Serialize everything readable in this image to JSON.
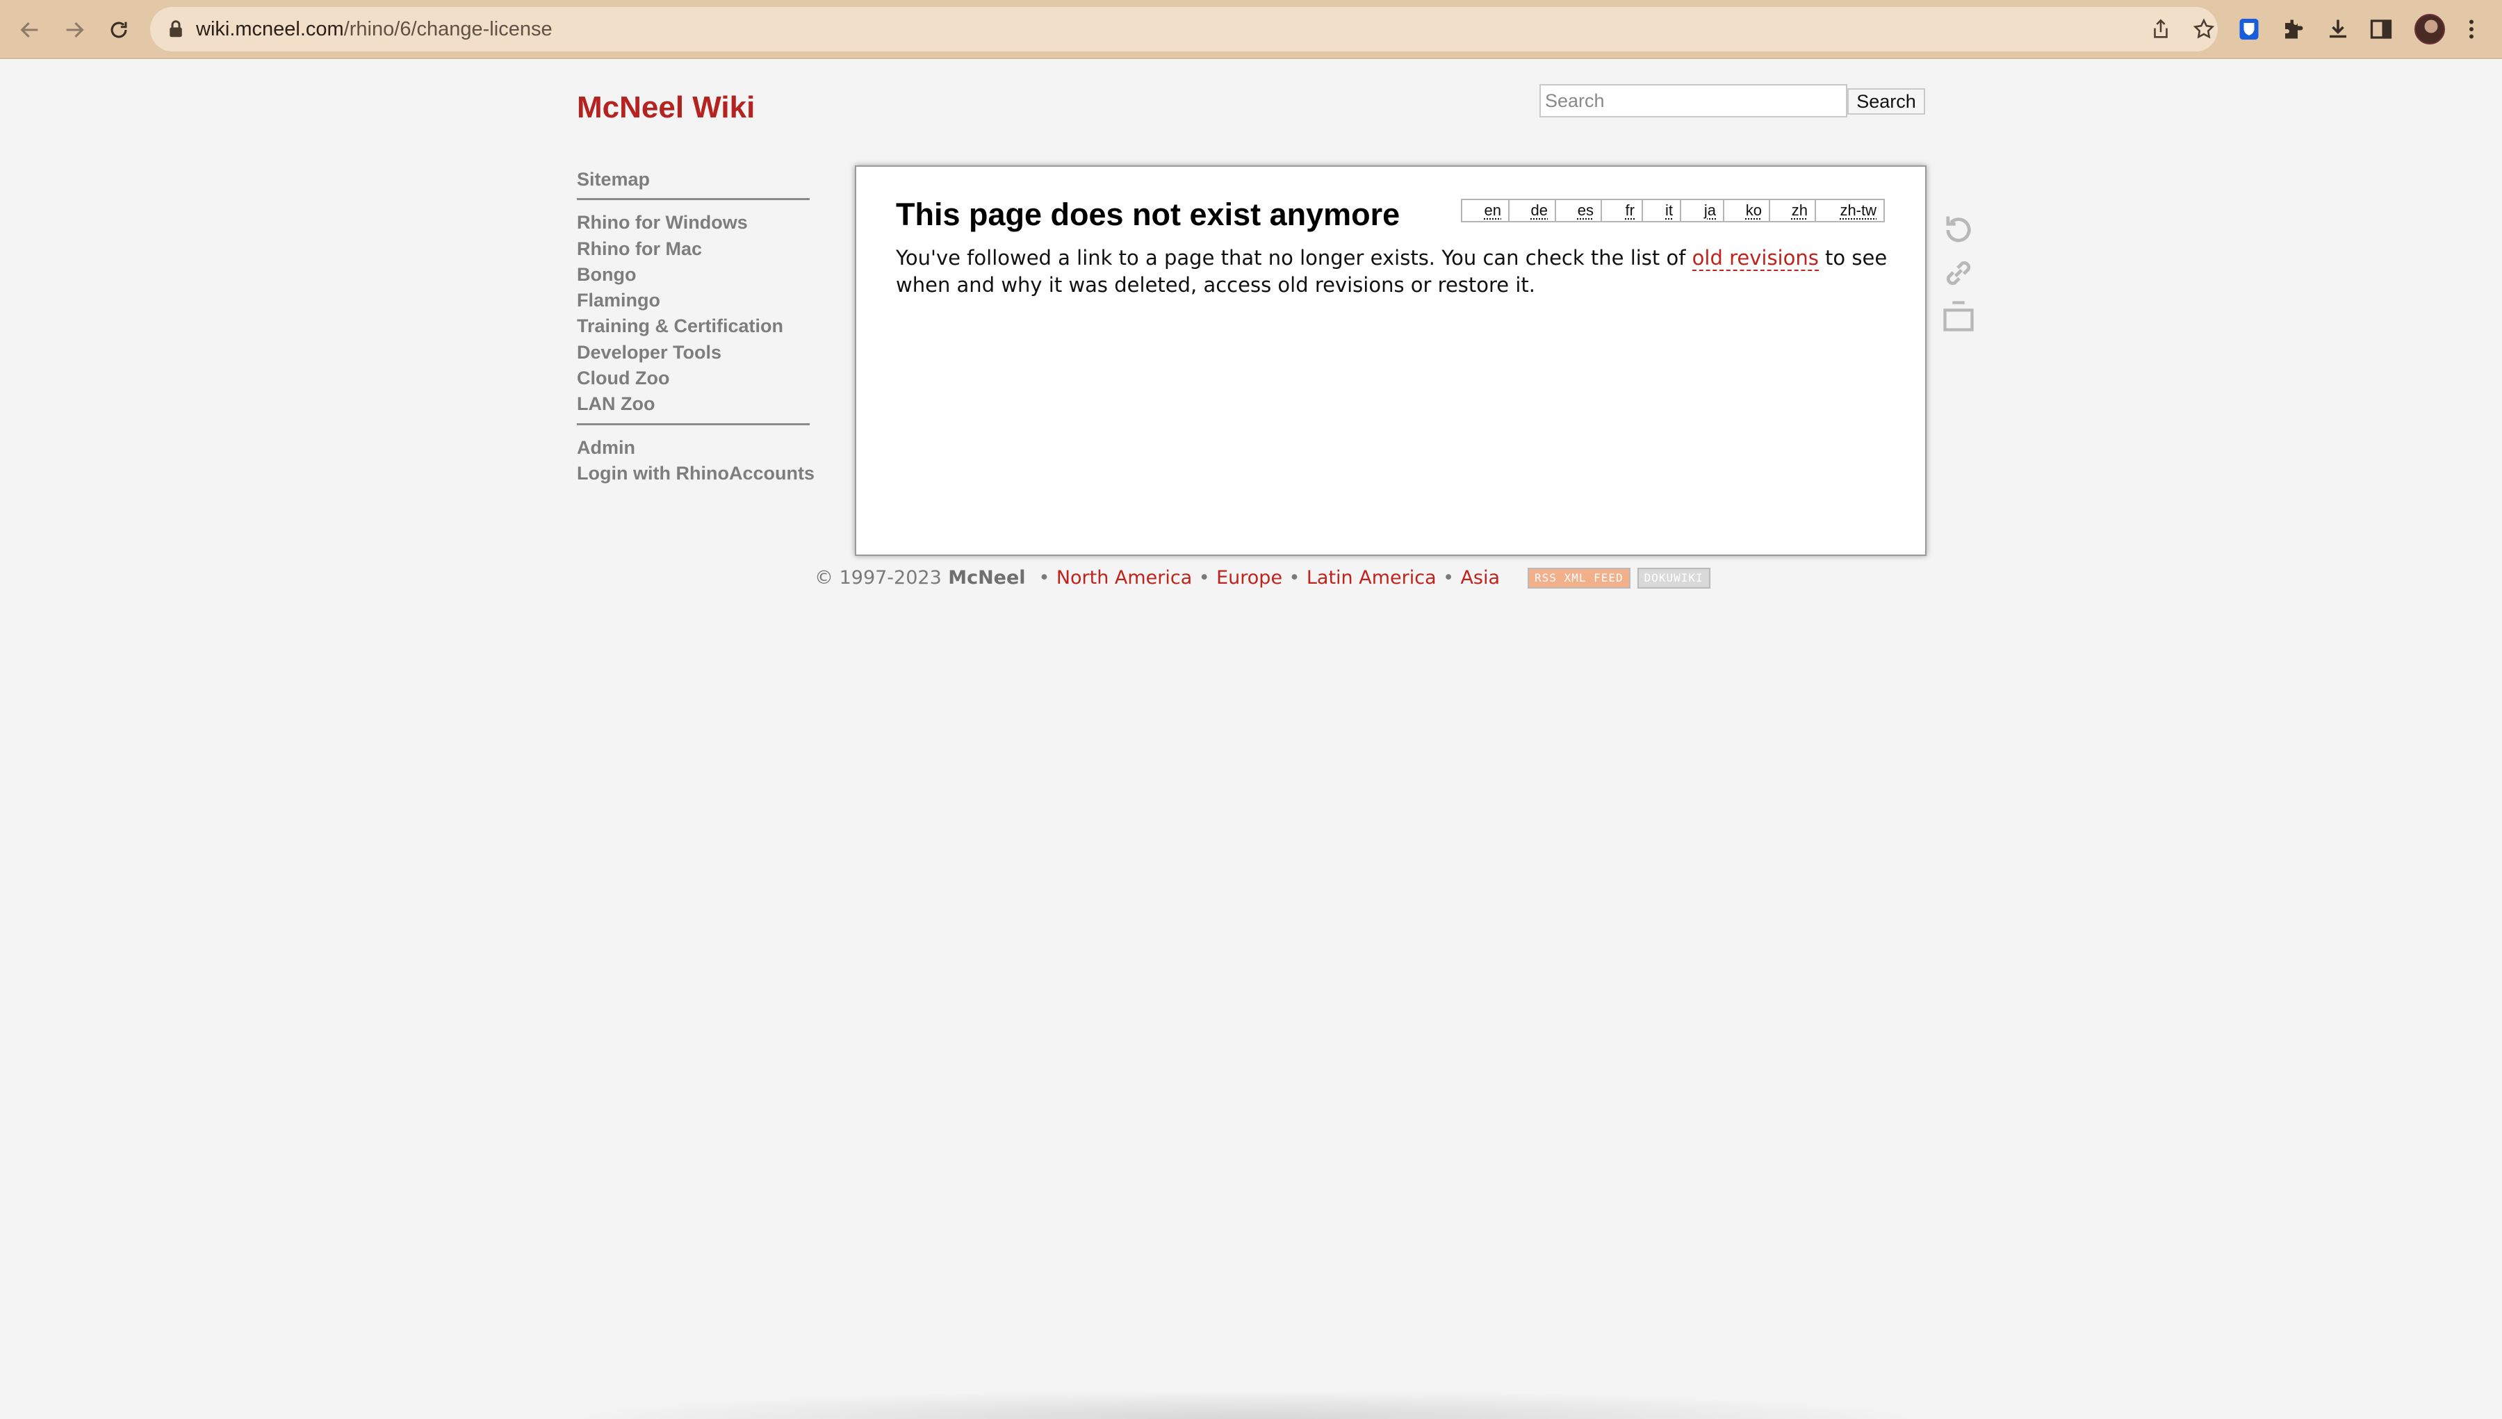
{
  "browser": {
    "url_host": "wiki.mcneel.com",
    "url_path": "/rhino/6/change-license",
    "icons": [
      "back-icon",
      "forward-icon",
      "reload-icon",
      "lock-icon",
      "share-icon",
      "bookmark-star-icon",
      "bitwarden-icon",
      "extensions-icon",
      "download-icon",
      "sidebar-icon",
      "avatar",
      "kebab-menu-icon"
    ]
  },
  "header": {
    "site_title": "McNeel Wiki",
    "search_placeholder": "Search",
    "search_button": "Search"
  },
  "sidebar": {
    "group1": [
      "Sitemap"
    ],
    "group2": [
      "Rhino for Windows",
      "Rhino for Mac",
      "Bongo",
      "Flamingo",
      "Training & Certification",
      "Developer Tools",
      "Cloud Zoo",
      "LAN Zoo"
    ],
    "group3": [
      "Admin",
      "Login with RhinoAccounts"
    ]
  },
  "content": {
    "title": "This page does not exist anymore",
    "languages": [
      "en",
      "de",
      "es",
      "fr",
      "it",
      "ja",
      "ko",
      "zh",
      "zh-tw"
    ],
    "text_before_link": "You've followed a link to a page that no longer exists. You can check the list of ",
    "link_text": "old revisions",
    "text_after_link": " to see when and why it was deleted, access old revisions or restore it."
  },
  "page_tools": [
    "old-revisions-icon",
    "backlinks-icon",
    "back-to-top-icon"
  ],
  "footer": {
    "copyright": "© 1997-2023",
    "brand": "McNeel",
    "regions": [
      "North America",
      "Europe",
      "Latin America",
      "Asia"
    ],
    "separator": "•",
    "badge_rss": "RSS XML FEED",
    "badge_doku": "DOKUWIKI"
  },
  "colors": {
    "brand_red": "#b4231f",
    "chrome_bg": "#e3c8a8",
    "page_bg": "#f4f4f4"
  }
}
